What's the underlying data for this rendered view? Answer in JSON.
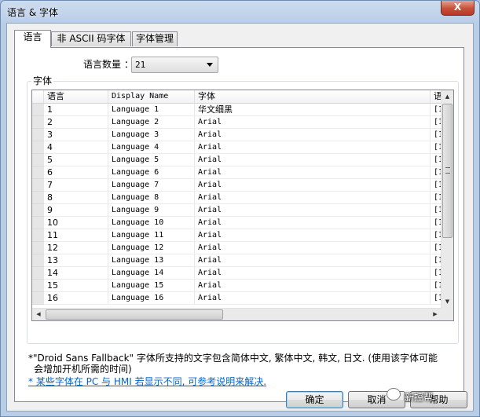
{
  "window": {
    "title": "语言 & 字体",
    "close_label": "X"
  },
  "tabs": [
    {
      "label": "语言"
    },
    {
      "label": "非 ASCII 码字体"
    },
    {
      "label": "字体管理"
    }
  ],
  "language_count": {
    "label": "语言数量 ：",
    "value": "21"
  },
  "group": {
    "title": "字体"
  },
  "table": {
    "columns": [
      "语言",
      "Display Name",
      "字体",
      "语"
    ],
    "rows": [
      [
        "1",
        "Language 1",
        "华文细黑",
        "[1"
      ],
      [
        "2",
        "Language 2",
        "Arial",
        "[1"
      ],
      [
        "3",
        "Language 3",
        "Arial",
        "[1"
      ],
      [
        "4",
        "Language 4",
        "Arial",
        "[1"
      ],
      [
        "5",
        "Language 5",
        "Arial",
        "[1"
      ],
      [
        "6",
        "Language 6",
        "Arial",
        "[1"
      ],
      [
        "7",
        "Language 7",
        "Arial",
        "[1"
      ],
      [
        "8",
        "Language 8",
        "Arial",
        "[1"
      ],
      [
        "9",
        "Language 9",
        "Arial",
        "[1"
      ],
      [
        "10",
        "Language 10",
        "Arial",
        "[1"
      ],
      [
        "11",
        "Language 11",
        "Arial",
        "[1"
      ],
      [
        "12",
        "Language 12",
        "Arial",
        "[1"
      ],
      [
        "13",
        "Language 13",
        "Arial",
        "[1"
      ],
      [
        "14",
        "Language 14",
        "Arial",
        "[1"
      ],
      [
        "15",
        "Language 15",
        "Arial",
        "[1"
      ],
      [
        "16",
        "Language 16",
        "Arial",
        "[1"
      ]
    ]
  },
  "notes": {
    "line1": "*\"Droid Sans Fallback\" 字体所支持的文字包含简体中文, 繁体中文, 韩文, 日文. (使用该字体可能",
    "line2": "会增加开机所需的时间)",
    "link": "* 某些字体在 PC 与 HMI 若显示不同, 可参考说明来解决."
  },
  "buttons": {
    "ok": "确定",
    "cancel": "取消",
    "help": "帮助"
  },
  "watermark": {
    "text": "新控帮"
  }
}
